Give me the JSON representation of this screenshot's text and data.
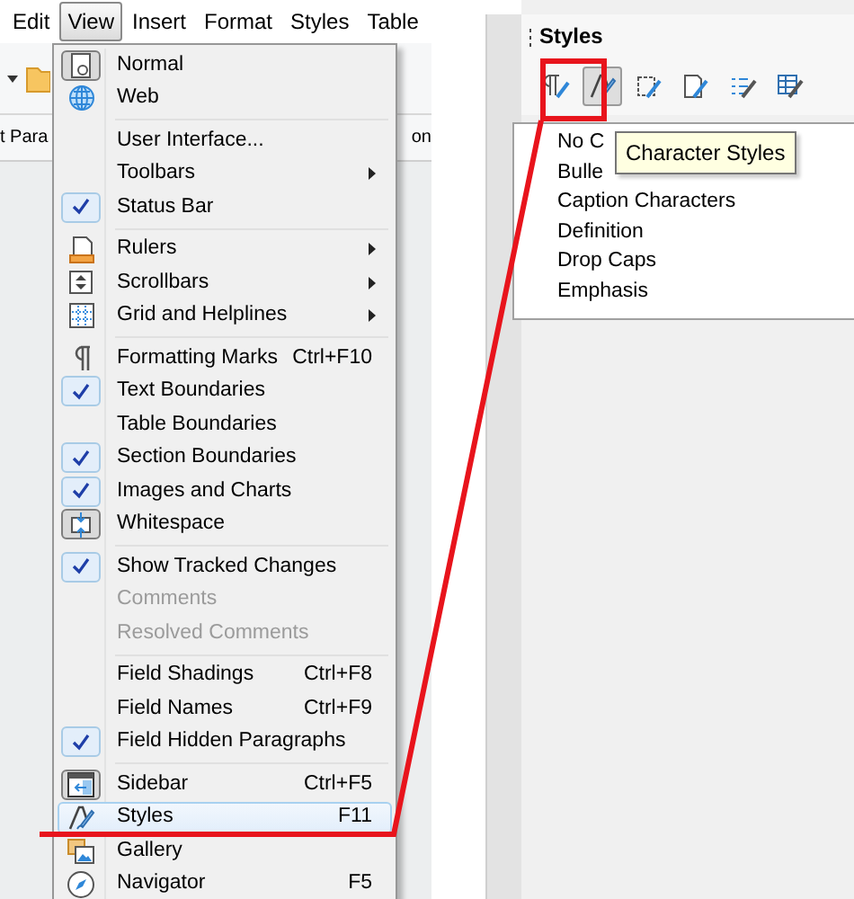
{
  "menubar": [
    {
      "label": "Edit",
      "selected": false
    },
    {
      "label": "View",
      "selected": true
    },
    {
      "label": "Insert",
      "selected": false
    },
    {
      "label": "Format",
      "selected": false
    },
    {
      "label": "Styles",
      "selected": false
    },
    {
      "label": "Table",
      "selected": false
    }
  ],
  "background_texts": [
    "t Para",
    "on"
  ],
  "view_menu": [
    {
      "kind": "item",
      "label": "Normal",
      "checked": true,
      "disabled": false,
      "selected": false,
      "submenu": false
    },
    {
      "kind": "item",
      "label": "Web",
      "checked": false,
      "disabled": false,
      "selected": false,
      "submenu": false
    },
    {
      "kind": "separator"
    },
    {
      "kind": "item",
      "label": "User Interface...",
      "checked": false,
      "disabled": false,
      "selected": false,
      "submenu": false
    },
    {
      "kind": "item",
      "label": "Toolbars",
      "checked": false,
      "disabled": false,
      "selected": false,
      "submenu": true
    },
    {
      "kind": "item",
      "label": "Status Bar",
      "checked": true,
      "disabled": false,
      "selected": false,
      "submenu": false
    },
    {
      "kind": "separator"
    },
    {
      "kind": "item",
      "label": "Rulers",
      "checked": false,
      "disabled": false,
      "selected": false,
      "submenu": true
    },
    {
      "kind": "item",
      "label": "Scrollbars",
      "checked": false,
      "disabled": false,
      "selected": false,
      "submenu": true
    },
    {
      "kind": "item",
      "label": "Grid and Helplines",
      "checked": false,
      "disabled": false,
      "selected": false,
      "submenu": true
    },
    {
      "kind": "separator"
    },
    {
      "kind": "item",
      "label": "Formatting Marks",
      "shortcut": "Ctrl+F10",
      "checked": false,
      "disabled": false,
      "selected": false,
      "submenu": false
    },
    {
      "kind": "item",
      "label": "Text Boundaries",
      "checked": true,
      "disabled": false,
      "selected": false,
      "submenu": false
    },
    {
      "kind": "item",
      "label": "Table Boundaries",
      "checked": false,
      "disabled": false,
      "selected": false,
      "submenu": false
    },
    {
      "kind": "item",
      "label": "Section Boundaries",
      "checked": true,
      "disabled": false,
      "selected": false,
      "submenu": false
    },
    {
      "kind": "item",
      "label": "Images and Charts",
      "checked": true,
      "disabled": false,
      "selected": false,
      "submenu": false
    },
    {
      "kind": "item",
      "label": "Whitespace",
      "checked": true,
      "disabled": false,
      "selected": false,
      "submenu": false
    },
    {
      "kind": "separator"
    },
    {
      "kind": "item",
      "label": "Show Tracked Changes",
      "checked": true,
      "disabled": false,
      "selected": false,
      "submenu": false
    },
    {
      "kind": "item",
      "label": "Comments",
      "checked": false,
      "disabled": true,
      "selected": false,
      "submenu": false
    },
    {
      "kind": "item",
      "label": "Resolved Comments",
      "checked": false,
      "disabled": true,
      "selected": false,
      "submenu": false
    },
    {
      "kind": "separator"
    },
    {
      "kind": "item",
      "label": "Field Shadings",
      "shortcut": "Ctrl+F8",
      "checked": false,
      "disabled": false,
      "selected": false,
      "submenu": false
    },
    {
      "kind": "item",
      "label": "Field Names",
      "shortcut": "Ctrl+F9",
      "checked": false,
      "disabled": false,
      "selected": false,
      "submenu": false
    },
    {
      "kind": "item",
      "label": "Field Hidden Paragraphs",
      "checked": true,
      "disabled": false,
      "selected": false,
      "submenu": false
    },
    {
      "kind": "separator"
    },
    {
      "kind": "item",
      "label": "Sidebar",
      "shortcut": "Ctrl+F5",
      "checked": true,
      "disabled": false,
      "selected": false,
      "submenu": false
    },
    {
      "kind": "item",
      "label": "Styles",
      "shortcut": "F11",
      "checked": false,
      "disabled": false,
      "selected": true,
      "submenu": false
    },
    {
      "kind": "item",
      "label": "Gallery",
      "checked": false,
      "disabled": false,
      "selected": false,
      "submenu": false
    },
    {
      "kind": "item",
      "label": "Navigator",
      "shortcut": "F5",
      "checked": false,
      "disabled": false,
      "selected": false,
      "submenu": false
    }
  ],
  "styles_panel": {
    "title": "Styles",
    "tools": [
      {
        "selected": false
      },
      {
        "selected": true
      },
      {
        "selected": false
      },
      {
        "selected": false
      },
      {
        "selected": false
      },
      {
        "selected": false
      }
    ],
    "tooltip": "Character Styles",
    "styles": [
      "No C",
      "Bulle",
      "Caption Characters",
      "Definition",
      "Drop Caps",
      "Emphasis"
    ]
  }
}
